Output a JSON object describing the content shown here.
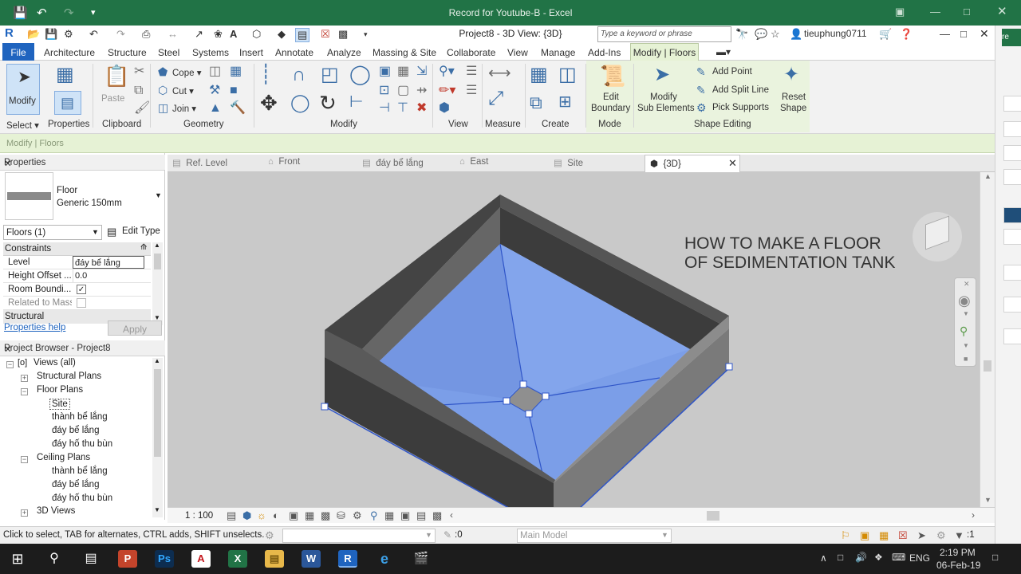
{
  "excel": {
    "title": "Record for Youtube-B - Excel"
  },
  "revit": {
    "title": "Project8 - 3D View: {3D}",
    "search_placeholder": "Type a keyword or phrase",
    "username": "tieuphung0711",
    "tabs": [
      "File",
      "Architecture",
      "Structure",
      "Steel",
      "Systems",
      "Insert",
      "Annotate",
      "Analyze",
      "Massing & Site",
      "Collaborate",
      "View",
      "Manage",
      "Add-Ins",
      "Modify | Floors"
    ],
    "ribbon": {
      "modify_label": "Modify",
      "select_label": "Select",
      "properties_label": "Properties",
      "paste_label": "Paste",
      "clipboard_label": "Clipboard",
      "cope_label": "Cope",
      "cut_label": "Cut",
      "join_label": "Join",
      "geometry_label": "Geometry",
      "modify_group_label": "Modify",
      "view_label": "View",
      "measure_label": "Measure",
      "create_label": "Create",
      "edit_boundary_line1": "Edit",
      "edit_boundary_line2": "Boundary",
      "mode_label": "Mode",
      "modify_sub_line1": "Modify",
      "modify_sub_line2": "Sub Elements",
      "add_point_label": "Add Point",
      "add_split_line_label": "Add Split Line",
      "pick_supports_label": "Pick Supports",
      "reset_shape_line1": "Reset",
      "reset_shape_line2": "Shape",
      "shape_editing_label": "Shape Editing"
    },
    "options_bar": "Modify | Floors",
    "properties": {
      "header": "Properties",
      "type_line1": "Floor",
      "type_line2": "Generic 150mm",
      "instance_selector": "Floors (1)",
      "edit_type": "Edit Type",
      "section_constraints": "Constraints",
      "rows": [
        {
          "key": "Level",
          "value": "đáy bể lắng"
        },
        {
          "key": "Height Offset ...",
          "value": "0.0"
        },
        {
          "key": "Room Boundi...",
          "value": ""
        },
        {
          "key": "Related to Mass",
          "value": ""
        }
      ],
      "section_structural": "Structural",
      "help_link": "Properties help",
      "apply_button": "Apply"
    },
    "project_browser": {
      "header": "Project Browser - Project8",
      "items": [
        {
          "label": "Views (all)"
        },
        {
          "label": "Structural Plans"
        },
        {
          "label": "Floor Plans"
        },
        {
          "label": "Site"
        },
        {
          "label": "thành bể lắng"
        },
        {
          "label": "đáy bể lắng"
        },
        {
          "label": "đáy hố thu bùn"
        },
        {
          "label": "Ceiling Plans"
        },
        {
          "label": "thành bể lắng"
        },
        {
          "label": "đáy bể lắng"
        },
        {
          "label": "đáy hố thu bùn"
        },
        {
          "label": "3D Views"
        }
      ]
    },
    "view_tabs": [
      "Ref. Level",
      "Front",
      "đáy bể lắng",
      "East",
      "Site",
      "{3D}"
    ],
    "overlay_line1": "HOW TO MAKE A FLOOR",
    "overlay_line2": "OF SEDIMENTATION TANK",
    "scale": "1 : 100",
    "status_message": "Click to select, TAB for alternates, CTRL adds, SHIFT unselects.",
    "status_zero": ":0",
    "status_model": "Main Model",
    "status_filter": ":1"
  },
  "taskbar": {
    "lang": "ENG",
    "time": "2:19 PM",
    "date": "06-Feb-19"
  },
  "colors": {
    "excel_green": "#217346",
    "revit_file_tab": "#1f64bf",
    "floor_blue": "#7b9ee8",
    "wall_dark": "#3c3c3c"
  }
}
